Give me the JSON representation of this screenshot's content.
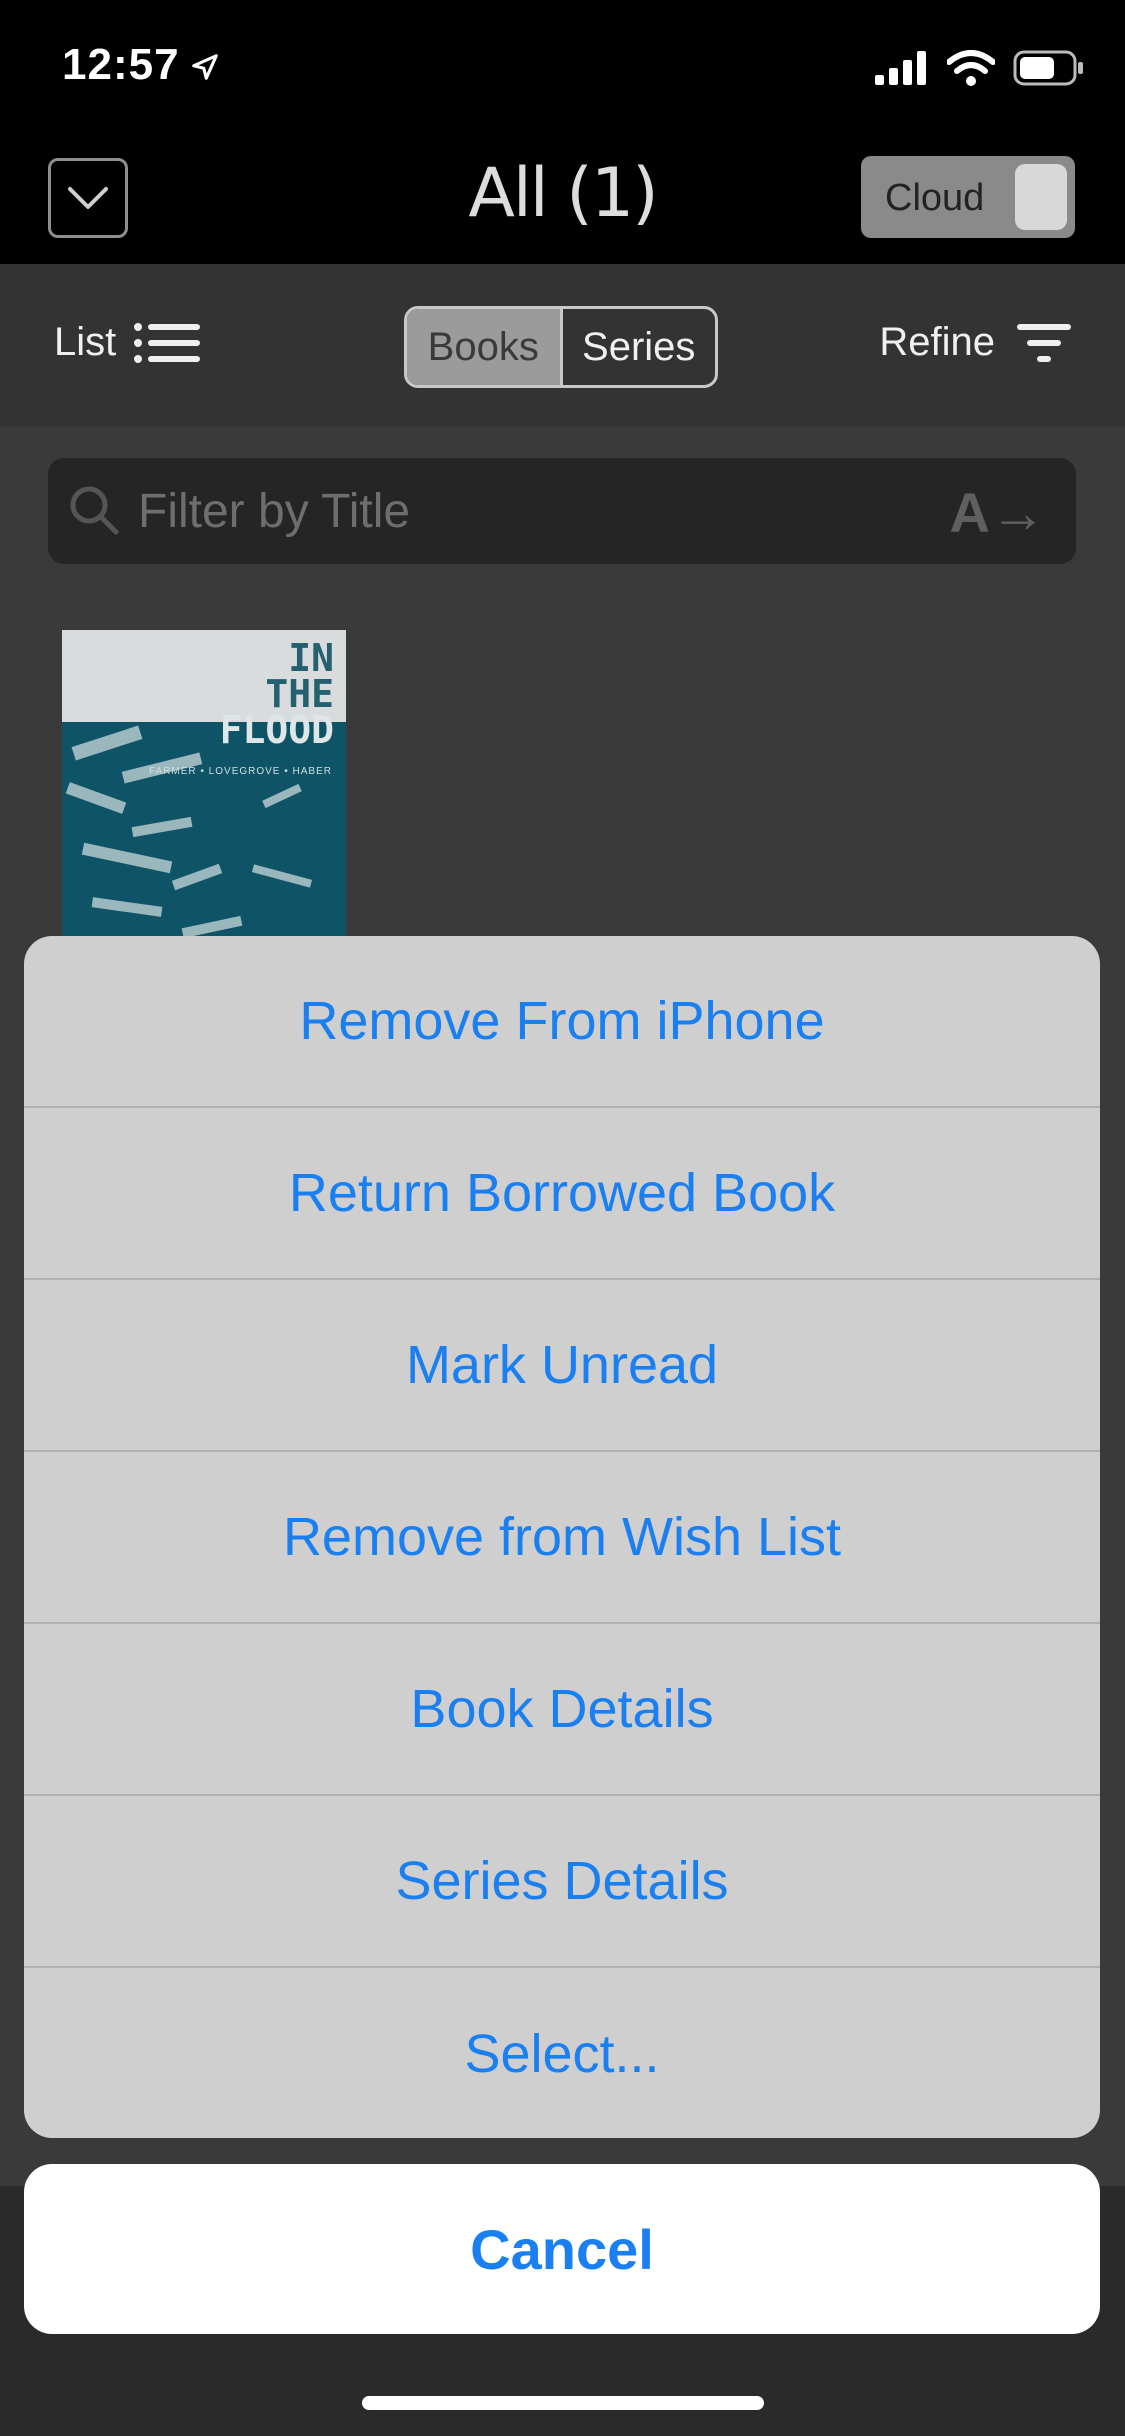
{
  "status": {
    "time": "12:57"
  },
  "nav": {
    "title": "All (1)",
    "cloud_label": "Cloud"
  },
  "toolbar": {
    "list_label": "List",
    "segments": [
      "Books",
      "Series"
    ],
    "refine_label": "Refine"
  },
  "search": {
    "placeholder": "Filter by Title",
    "sort_label": "A→"
  },
  "book": {
    "cover_title_lines": [
      "IN",
      "THE",
      "FLOOD"
    ],
    "cover_authors": "FARMER • LOVEGROVE • HABER"
  },
  "action_sheet": {
    "items": [
      "Remove From iPhone",
      "Return Borrowed Book",
      "Mark Unread",
      "Remove from Wish List",
      "Book Details",
      "Series Details",
      "Select..."
    ],
    "cancel_label": "Cancel"
  },
  "colors": {
    "accent": "#1a7ff0",
    "sheet_bg": "#cfcfcf",
    "cover_teal": "#0f5466"
  }
}
